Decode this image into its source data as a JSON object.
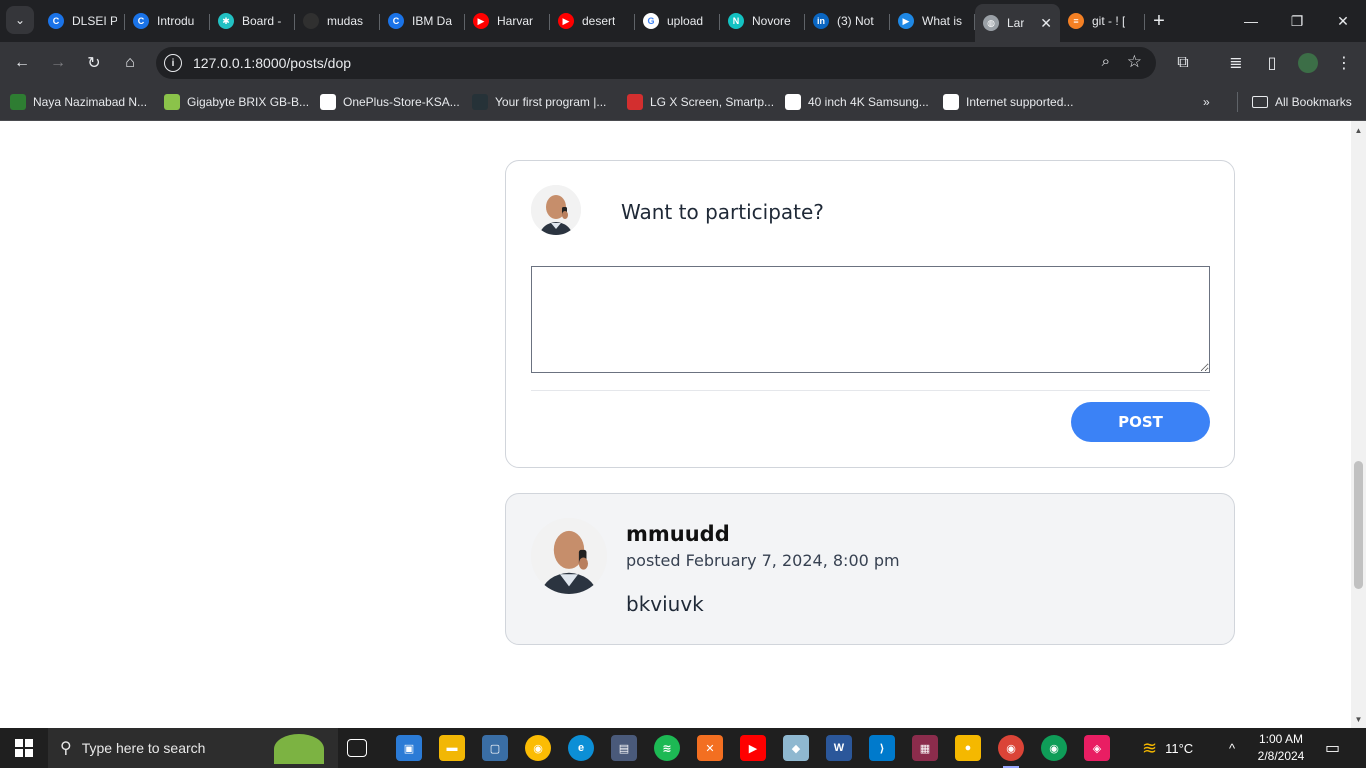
{
  "browser": {
    "tabs": [
      {
        "title": "DLSEI P",
        "icon_color": "#1a73e8",
        "icon_text": "C"
      },
      {
        "title": "Introdu",
        "icon_color": "#1a73e8",
        "icon_text": "C"
      },
      {
        "title": "Board -",
        "icon_color": "#22c1c3",
        "icon_text": "✱"
      },
      {
        "title": "mudas",
        "icon_color": "#303030",
        "icon_text": ""
      },
      {
        "title": "IBM Da",
        "icon_color": "#1a73e8",
        "icon_text": "C"
      },
      {
        "title": "Harvar",
        "icon_color": "#ff0000",
        "icon_text": "▶"
      },
      {
        "title": "desert",
        "icon_color": "#ff0000",
        "icon_text": "▶"
      },
      {
        "title": "upload",
        "icon_color": "#ffffff",
        "icon_text": "G"
      },
      {
        "title": "Novore",
        "icon_color": "#13c2c2",
        "icon_text": "N"
      },
      {
        "title": "(3) Not",
        "icon_color": "#0a66c2",
        "icon_text": "in"
      },
      {
        "title": "What is",
        "icon_color": "#1e88e5",
        "icon_text": "▶"
      },
      {
        "title": "Lar",
        "icon_color": "#9aa0a6",
        "icon_text": "◍",
        "active": true
      },
      {
        "title": "git - ! [",
        "icon_color": "#f48024",
        "icon_text": "≡"
      }
    ],
    "url": "127.0.0.1:8000/posts/dop",
    "bookmarks": [
      {
        "label": "Naya Nazimabad N...",
        "icon_color": "#2e7d32"
      },
      {
        "label": "Gigabyte BRIX GB-B...",
        "icon_color": "#8bc34a"
      },
      {
        "label": "OnePlus-Store-KSA...",
        "icon_color": "#ffffff"
      },
      {
        "label": "Your first program |...",
        "icon_color": "#263238"
      },
      {
        "label": "LG X Screen, Smartp...",
        "icon_color": "#d32f2f"
      },
      {
        "label": "40 inch 4K Samsung...",
        "icon_color": "#ffffff"
      },
      {
        "label": "Internet supported...",
        "icon_color": "#ffffff"
      }
    ],
    "all_bookmarks_label": "All Bookmarks"
  },
  "comment_form": {
    "prompt": "Want to participate?",
    "textarea_value": "",
    "post_button_label": "POST"
  },
  "comments": [
    {
      "username": "mmuudd",
      "posted": "posted February 7, 2024, 8:00 pm",
      "body": "bkviuvk"
    }
  ],
  "taskbar": {
    "search_placeholder": "Type here to search",
    "weather": "11°C",
    "time": "1:00 AM",
    "date": "2/8/2024"
  },
  "colors": {
    "accent": "#3b82f6",
    "comment_bg": "#f3f4f6",
    "browser_dark": "#202124"
  }
}
